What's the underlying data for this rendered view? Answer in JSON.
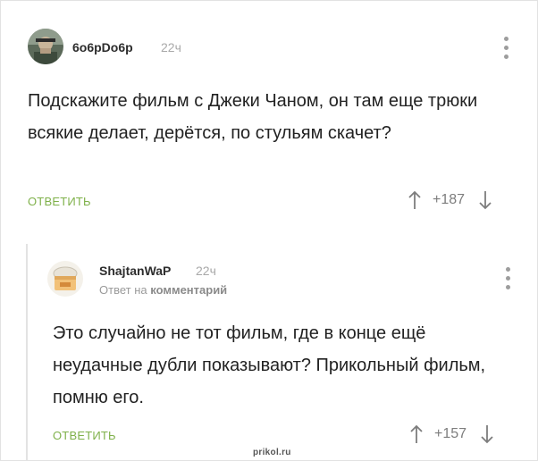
{
  "comments": [
    {
      "author": "6o6pDo6p",
      "time": "22ч",
      "text": "Подскажите фильм с Джеки Чаном, он там еще трюки всякие делает, дерётся, по стульям скачет?",
      "reply_label": "ОТВЕТИТЬ",
      "score": "+187"
    },
    {
      "author": "ShajtanWaP",
      "time": "22ч",
      "reply_to_prefix": "Ответ на",
      "reply_to_target": "комментарий",
      "text": "Это случайно не тот фильм, где в конце ещё неудачные дубли показывают? Прикольный фильм, помню его.",
      "reply_label": "ОТВЕТИТЬ",
      "score": "+157"
    }
  ],
  "watermark": "prikol.ru",
  "colors": {
    "accent_reply": "#7fb14a",
    "muted": "#a9a9a9",
    "thread_line": "#e3e3e3"
  }
}
